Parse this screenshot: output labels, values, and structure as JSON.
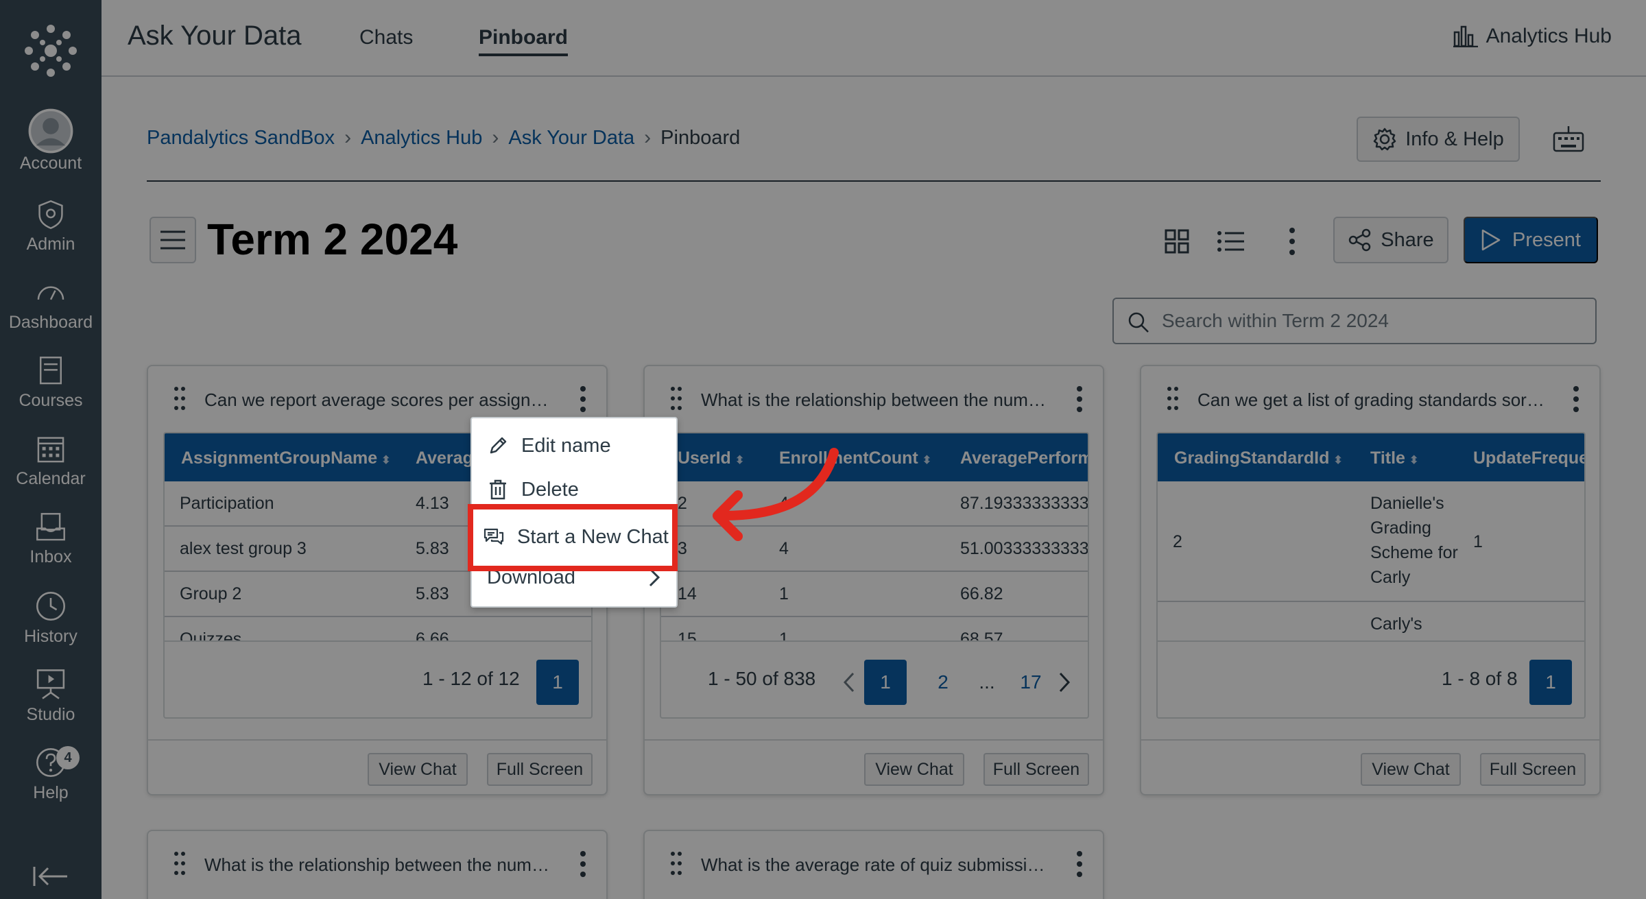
{
  "global_nav": {
    "items": [
      {
        "label": "Account",
        "icon": "account-icon"
      },
      {
        "label": "Admin",
        "icon": "admin-icon"
      },
      {
        "label": "Dashboard",
        "icon": "dashboard-icon"
      },
      {
        "label": "Courses",
        "icon": "courses-icon"
      },
      {
        "label": "Calendar",
        "icon": "calendar-icon"
      },
      {
        "label": "Inbox",
        "icon": "inbox-icon"
      },
      {
        "label": "History",
        "icon": "history-icon"
      },
      {
        "label": "Studio",
        "icon": "studio-icon"
      },
      {
        "label": "Help",
        "icon": "help-icon",
        "badge": "4"
      }
    ]
  },
  "topbar": {
    "app_title": "Ask Your Data",
    "tabs": [
      {
        "label": "Chats"
      },
      {
        "label": "Pinboard",
        "active": true
      }
    ],
    "hub_link": "Analytics Hub"
  },
  "breadcrumb": {
    "links": [
      "Pandalytics SandBox",
      "Analytics Hub",
      "Ask Your Data"
    ],
    "current": "Pinboard"
  },
  "info_help_label": "Info & Help",
  "page": {
    "title": "Term 2 2024",
    "share_label": "Share",
    "present_label": "Present",
    "search_placeholder": "Search within Term 2 2024"
  },
  "cards": [
    {
      "title": "Can we report average scores per assignment group?",
      "columns": [
        "AssignmentGroupName",
        "Averag"
      ],
      "rows": [
        [
          "Participation",
          "4.13"
        ],
        [
          "alex test group 3",
          "5.83"
        ],
        [
          "Group 2",
          "5.83"
        ],
        [
          "Quizzes",
          "6.66"
        ]
      ],
      "range": "1 - 12 of 12",
      "pages": [
        "1"
      ],
      "view_chat": "View Chat",
      "full_screen": "Full Screen"
    },
    {
      "title": "What is the relationship between the number of enrollments and performance?",
      "columns": [
        "UserId",
        "EnrollmentCount",
        "AveragePerform"
      ],
      "rows": [
        [
          "2",
          "4",
          "87.19333333333"
        ],
        [
          "3",
          "4",
          "51.00333333333"
        ],
        [
          "14",
          "1",
          "66.82"
        ],
        [
          "15",
          "1",
          "68.57"
        ]
      ],
      "range": "1 - 50 of 838",
      "pages": [
        "1",
        "2",
        "...",
        "17"
      ],
      "view_chat": "View Chat",
      "full_screen": "Full Screen"
    },
    {
      "title": "Can we get a list of grading standards sorted by update frequency?",
      "columns": [
        "GradingStandardId",
        "Title",
        "UpdateFreque"
      ],
      "rows": [
        [
          "2",
          "Danielle's Grading Scheme for Carly",
          "1"
        ],
        [
          "",
          "Carly's",
          ""
        ]
      ],
      "range": "1 - 8 of 8",
      "pages": [
        "1"
      ],
      "view_chat": "View Chat",
      "full_screen": "Full Screen"
    },
    {
      "title": "What is the relationship between the number of submissions and scores?"
    },
    {
      "title": "What is the average rate of quiz submissions per course?"
    }
  ],
  "dropdown": {
    "items": [
      {
        "label": "Edit name",
        "icon": "pencil-icon"
      },
      {
        "label": "Delete",
        "icon": "trash-icon"
      },
      {
        "label": "Start a New Chat",
        "icon": "chat-icon",
        "highlighted": true
      },
      {
        "label": "Download",
        "icon": "chevron-right-icon"
      }
    ]
  },
  "colors": {
    "nav_bg": "#394b58",
    "brand_blue": "#0b5ea6",
    "highlight_red": "#e2281e"
  }
}
